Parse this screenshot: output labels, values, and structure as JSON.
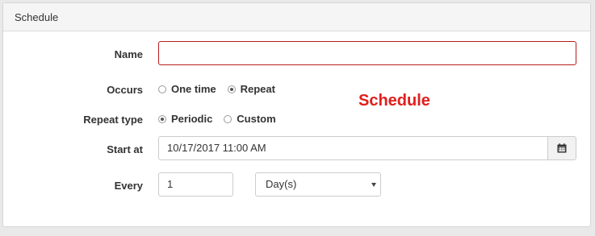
{
  "panel": {
    "title": "Schedule"
  },
  "form": {
    "name": {
      "label": "Name",
      "value": ""
    },
    "occurs": {
      "label": "Occurs",
      "options": [
        {
          "label": "One time",
          "checked": false
        },
        {
          "label": "Repeat",
          "checked": true
        }
      ]
    },
    "repeat_type": {
      "label": "Repeat type",
      "options": [
        {
          "label": "Periodic",
          "checked": true
        },
        {
          "label": "Custom",
          "checked": false
        }
      ]
    },
    "start_at": {
      "label": "Start at",
      "value": "10/17/2017 11:00 AM",
      "icon": "calendar-icon"
    },
    "every": {
      "label": "Every",
      "value": "1",
      "unit": "Day(s)"
    }
  },
  "annotation": {
    "text": "Schedule",
    "color": "#e0201d"
  },
  "colors": {
    "invalid_border": "#b71c1c",
    "panel_heading_bg": "#f5f5f5"
  }
}
